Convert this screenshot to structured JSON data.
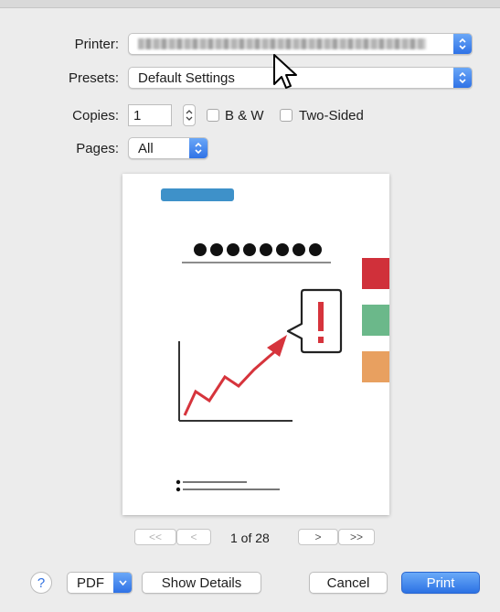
{
  "printer": {
    "label": "Printer:",
    "value": ""
  },
  "presets": {
    "label": "Presets:",
    "value": "Default Settings"
  },
  "copies": {
    "label": "Copies:",
    "value": "1",
    "bw_label": "B & W",
    "two_sided_label": "Two-Sided",
    "bw_checked": false,
    "two_sided_checked": false
  },
  "pages": {
    "label": "Pages:",
    "value": "All"
  },
  "navigation": {
    "first": "<<",
    "prev": "<",
    "next": ">",
    "last": ">>",
    "page_status": "1 of 28"
  },
  "footer": {
    "help": "?",
    "pdf": "PDF",
    "show_details": "Show Details",
    "cancel": "Cancel",
    "print": "Print"
  },
  "icons": {
    "popup_arrows": "chevron-updown-icon",
    "pdf_menu": "chevron-down-icon",
    "cursor": "mouse-pointer-icon"
  },
  "colors": {
    "accent": "#2f72e6",
    "preview_bar": "#3e91c9",
    "tab_red": "#d0303a",
    "tab_green": "#6bb88a",
    "tab_orange": "#e8a060",
    "arrow_red": "#d6343c"
  }
}
